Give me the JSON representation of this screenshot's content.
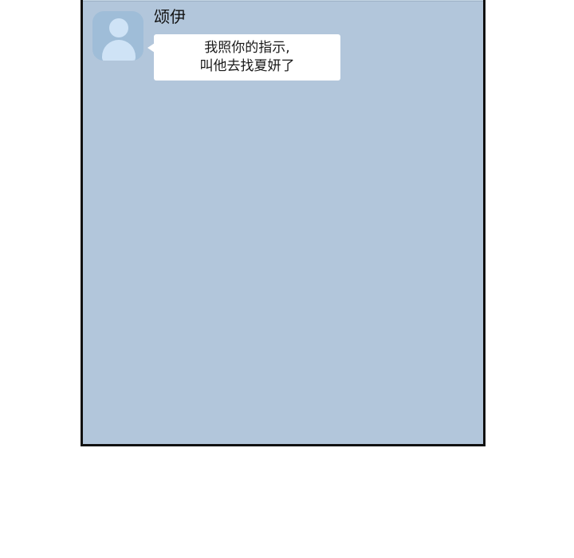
{
  "chat": {
    "message": {
      "sender_name": "颂伊",
      "lines": [
        "我照你的指示,",
        "叫他去找夏妍了"
      ]
    }
  },
  "colors": {
    "chat_background": "#b2c6db",
    "bubble": "#ffffff",
    "avatar": "#9fbdd8",
    "frame_border": "#111111"
  },
  "icons": {
    "avatar": "default-user-silhouette"
  }
}
